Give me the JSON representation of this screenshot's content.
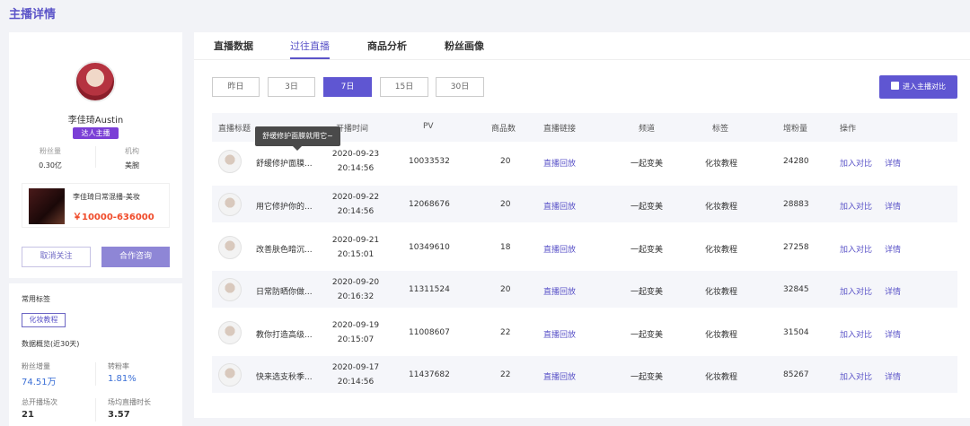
{
  "page_title": "主播详情",
  "anchor": {
    "name": "李佳琦Austin",
    "badge": "达人主播",
    "fans_label": "粉丝量",
    "fans_value": "0.30亿",
    "org_label": "机构",
    "org_value": "美腕"
  },
  "live_card": {
    "title": "李佳琦日常混播-美妆",
    "price": "￥10000-636000"
  },
  "buttons": {
    "unfollow": "取消关注",
    "cooperate": "合作咨询",
    "compare": "进入主播对比"
  },
  "tags_section": {
    "label": "常用标签",
    "tag": "化妆教程"
  },
  "overview": {
    "label": "数据概览(近30天)",
    "kpis": [
      {
        "label": "粉丝增量",
        "value": "74.51万"
      },
      {
        "label": "转粉率",
        "value": "1.81%"
      },
      {
        "label": "总开播场次",
        "value": "21"
      },
      {
        "label": "场均直播时长",
        "value": "3.57"
      }
    ]
  },
  "tabs": [
    "直播数据",
    "过往直播",
    "商品分析",
    "粉丝画像"
  ],
  "active_tab": "过往直播",
  "ranges": [
    "昨日",
    "3日",
    "7日",
    "15日",
    "30日"
  ],
  "active_range": "7日",
  "table": {
    "headers": [
      "直播标题",
      "开播时间",
      "PV",
      "商品数",
      "直播链接",
      "频道",
      "标签",
      "增粉量",
      "操作"
    ],
    "rows": [
      {
        "title": "舒缓修护面膜...",
        "date": "2020-09-23",
        "time": "20:14:56",
        "pv": "10033532",
        "count": "20",
        "link": "直播回放",
        "channel": "一起变美",
        "tag": "化妆教程",
        "fans": "24280",
        "op1": "加入对比",
        "op2": "详情"
      },
      {
        "title": "用它修护你的...",
        "date": "2020-09-22",
        "time": "20:14:56",
        "pv": "12068676",
        "count": "20",
        "link": "直播回放",
        "channel": "一起变美",
        "tag": "化妆教程",
        "fans": "28883",
        "op1": "加入对比",
        "op2": "详情"
      },
      {
        "title": "改善肤色暗沉...",
        "date": "2020-09-21",
        "time": "20:15:01",
        "pv": "10349610",
        "count": "18",
        "link": "直播回放",
        "channel": "一起变美",
        "tag": "化妆教程",
        "fans": "27258",
        "op1": "加入对比",
        "op2": "详情"
      },
      {
        "title": "日常防晒你做...",
        "date": "2020-09-20",
        "time": "20:16:32",
        "pv": "11311524",
        "count": "20",
        "link": "直播回放",
        "channel": "一起变美",
        "tag": "化妆教程",
        "fans": "32845",
        "op1": "加入对比",
        "op2": "详情"
      },
      {
        "title": "教你打造高级...",
        "date": "2020-09-19",
        "time": "20:15:07",
        "pv": "11008607",
        "count": "22",
        "link": "直播回放",
        "channel": "一起变美",
        "tag": "化妆教程",
        "fans": "31504",
        "op1": "加入对比",
        "op2": "详情"
      },
      {
        "title": "快来选支秋季...",
        "date": "2020-09-17",
        "time": "20:14:56",
        "pv": "11437682",
        "count": "22",
        "link": "直播回放",
        "channel": "一起变美",
        "tag": "化妆教程",
        "fans": "85267",
        "op1": "加入对比",
        "op2": "详情"
      }
    ]
  },
  "tooltip": "舒缓修护面膜就用它~"
}
